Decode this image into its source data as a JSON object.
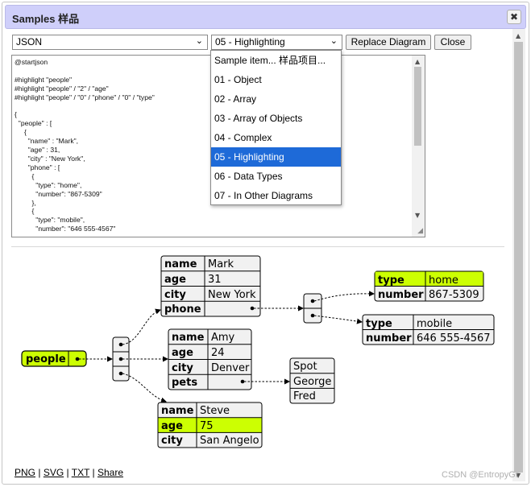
{
  "dialog": {
    "title": "Samples 样品",
    "close_glyph": "✖"
  },
  "toolbar": {
    "language_select": "JSON",
    "sample_select": "05 - Highlighting",
    "replace_button": "Replace Diagram",
    "close_button": "Close"
  },
  "dropdown": {
    "items": [
      "Sample item... 样品项目...",
      "01 - Object",
      "02 - Array",
      "03 - Array of Objects",
      "04 - Complex",
      "05 - Highlighting",
      "06 - Data Types",
      "07 - In Other Diagrams"
    ],
    "selected_index": 5
  },
  "editor": {
    "text": "@startjson\n\n#highlight \"people\"\n#highlight \"people\" / \"2\" / \"age\"\n#highlight \"people\" / \"0\" / \"phone\" / \"0\" / \"type\"\n\n{\n  \"people\" : [\n     {\n       \"name\" : \"Mark\",\n       \"age\" : 31,\n       \"city\" : \"New York\",\n       \"phone\" : [\n         {\n           \"type\": \"home\",\n           \"number\": \"867-5309\"\n         },\n         {\n           \"type\": \"mobile\",\n           \"number\": \"646 555-4567\""
  },
  "diagram": {
    "highlight_color": "#ccff02",
    "root_label": "people",
    "person_mark": {
      "name_key": "name",
      "name": "Mark",
      "age_key": "age",
      "age": "31",
      "city_key": "city",
      "city": "New York",
      "phone_key": "phone"
    },
    "person_amy": {
      "name_key": "name",
      "name": "Amy",
      "age_key": "age",
      "age": "24",
      "city_key": "city",
      "city": "Denver",
      "pets_key": "pets"
    },
    "person_steve": {
      "name_key": "name",
      "name": "Steve",
      "age_key": "age",
      "age": "75",
      "city_key": "city",
      "city": "San Angelo"
    },
    "phone_home": {
      "type_key": "type",
      "type": "home",
      "number_key": "number",
      "number": "867-5309"
    },
    "phone_mobile": {
      "type_key": "type",
      "type": "mobile",
      "number_key": "number",
      "number": "646 555-4567"
    },
    "pets": [
      "Spot",
      "George",
      "Fred"
    ]
  },
  "export_links": {
    "png": "PNG",
    "svg": "SVG",
    "txt": "TXT",
    "share": "Share",
    "separator": " | "
  },
  "watermark": "CSDN @EntropyGr"
}
